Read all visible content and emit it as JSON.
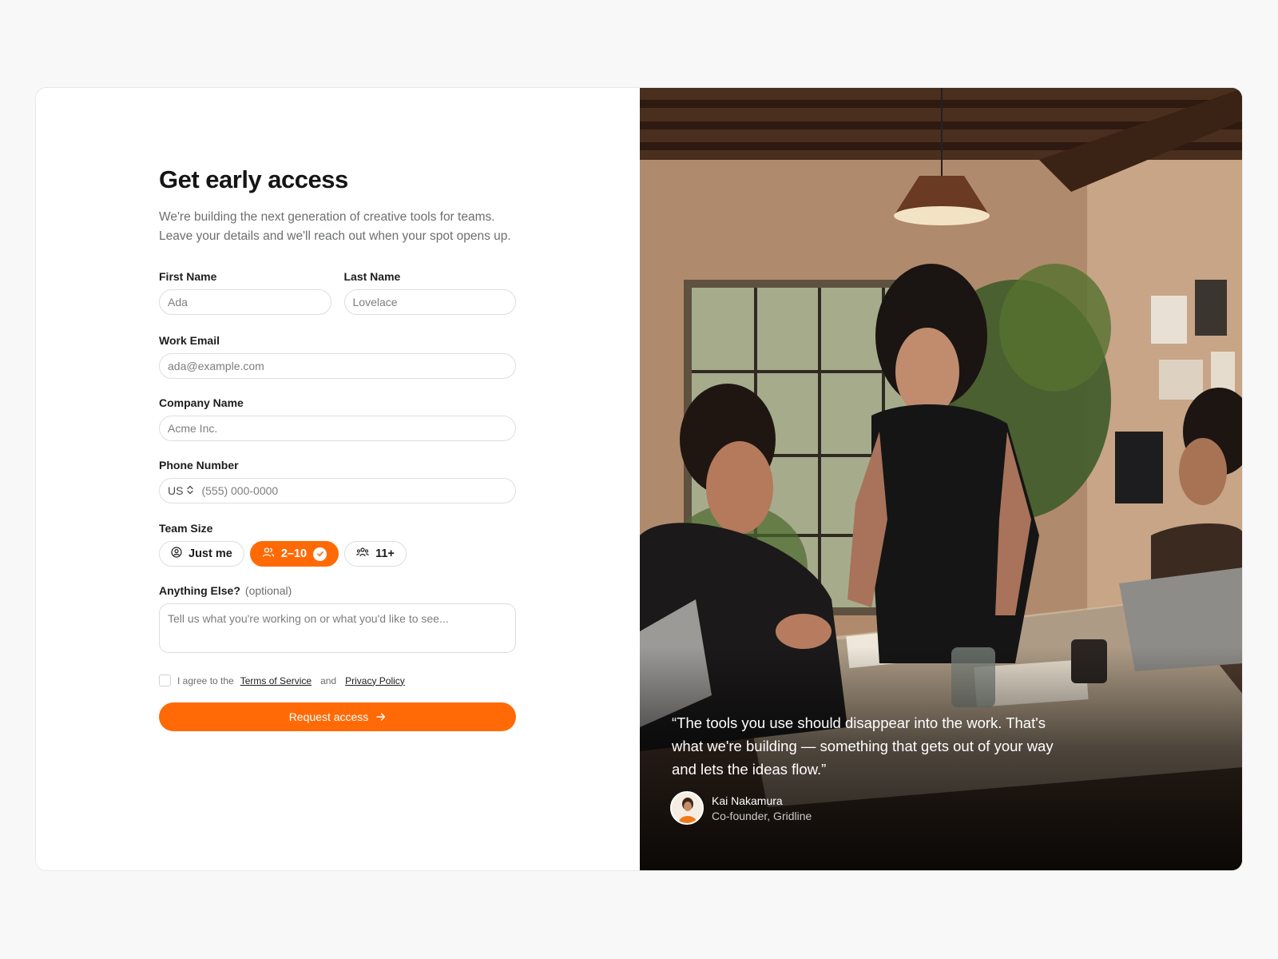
{
  "form": {
    "title": "Get early access",
    "subtitle": "We're building the next generation of creative tools for teams. Leave your details and we'll reach out when your spot opens up.",
    "first_name": {
      "label": "First Name",
      "placeholder": "Ada"
    },
    "last_name": {
      "label": "Last Name",
      "placeholder": "Lovelace"
    },
    "email": {
      "label": "Work Email",
      "placeholder": "ada@example.com"
    },
    "company": {
      "label": "Company Name",
      "placeholder": "Acme Inc."
    },
    "phone": {
      "label": "Phone Number",
      "country": "US",
      "placeholder": "(555) 000-0000"
    },
    "team_size": {
      "label": "Team Size",
      "options": [
        {
          "label": "Just me",
          "icon": "user-circle-icon"
        },
        {
          "label": "2–10",
          "icon": "users-icon",
          "selected": true
        },
        {
          "label": "11+",
          "icon": "group-icon"
        }
      ]
    },
    "notes": {
      "label": "Anything Else?",
      "optional": "(optional)",
      "placeholder": "Tell us what you're working on or what you'd like to see..."
    },
    "agreement": {
      "prefix": "I agree to the",
      "terms": "Terms of Service",
      "and": "and",
      "privacy": "Privacy Policy"
    },
    "submit_label": "Request access"
  },
  "testimonial": {
    "quote": "“The tools you use should disappear into the work. That's what we're building — something that gets out of your way and lets the ideas flow.”",
    "name": "Kai Nakamura",
    "role": "Co-founder, Gridline"
  },
  "colors": {
    "accent": "#ff6a06",
    "background": "#f7f8f7"
  }
}
